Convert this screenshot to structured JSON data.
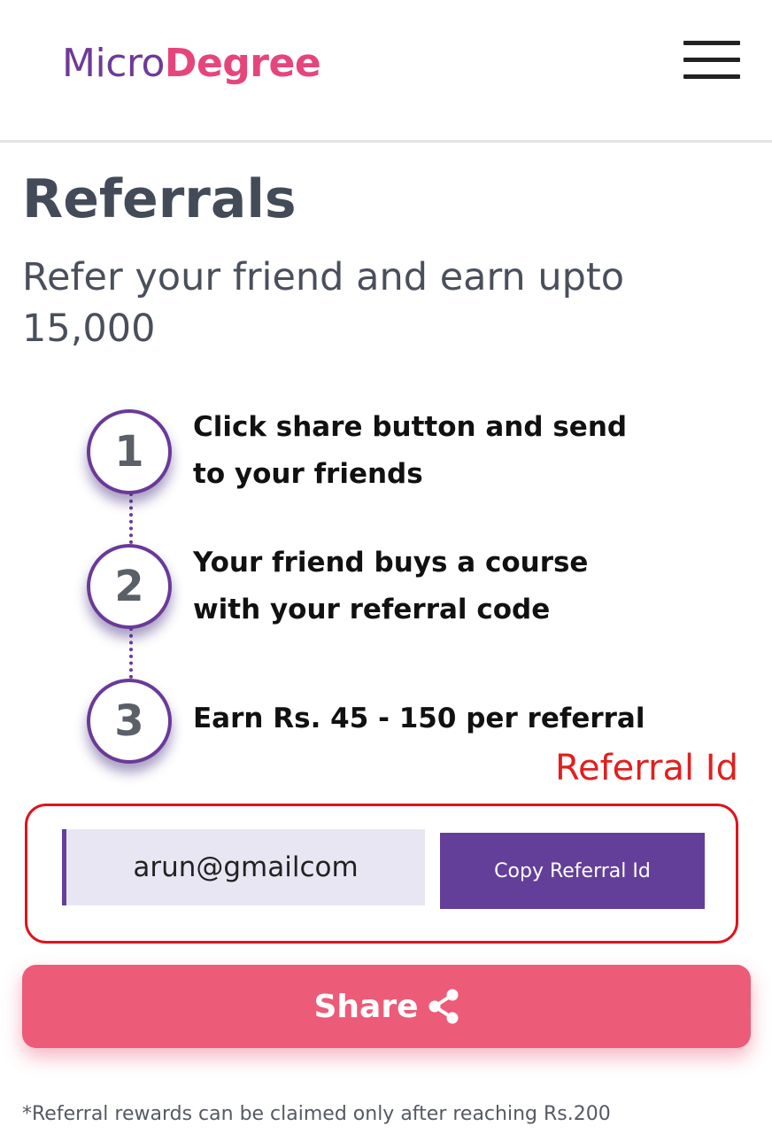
{
  "header": {
    "logo_part1": "Micro",
    "logo_part2": "Degree"
  },
  "page": {
    "title": "Referrals",
    "subtitle": "Refer your friend and earn upto 15,000"
  },
  "steps": [
    {
      "number": "1",
      "text": "Click share button and send to your friends"
    },
    {
      "number": "2",
      "text": "Your friend buys a course with your referral code"
    },
    {
      "number": "3",
      "text": "Earn Rs. 45 - 150 per referral"
    }
  ],
  "referral": {
    "label": "Referral Id",
    "id_value": "arun@gmailcom",
    "copy_label": "Copy Referral Id"
  },
  "share": {
    "label": "Share",
    "icon": "share-icon"
  },
  "footnote": "*Referral rewards can be claimed only after reaching Rs.200",
  "colors": {
    "logo_purple": "#6e3b96",
    "logo_pink": "#e6457c",
    "accent_purple": "#633f99",
    "share_pink": "#ec5b78",
    "highlight_red": "#e1121c"
  }
}
